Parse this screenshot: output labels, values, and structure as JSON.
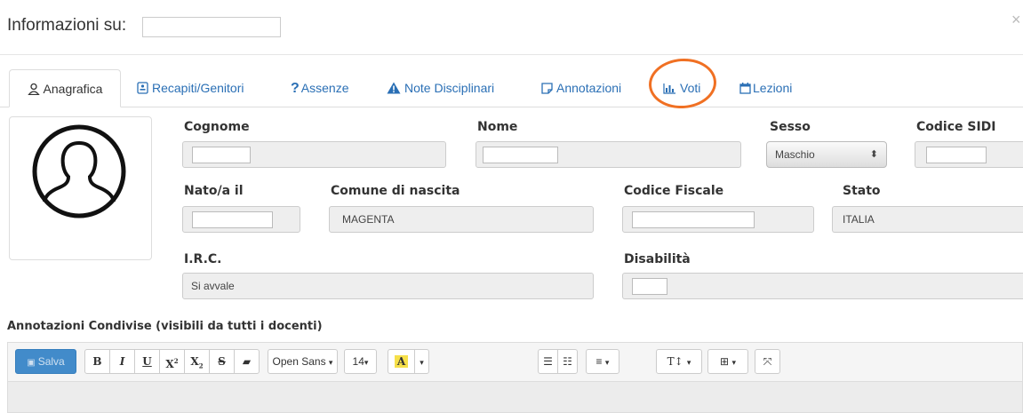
{
  "window": {
    "title": "Informazioni su:",
    "close": "×"
  },
  "tabs": [
    {
      "label": "Anagrafica",
      "icon": "user-icon"
    },
    {
      "label": "Recapiti/Genitori",
      "icon": "address-book-icon"
    },
    {
      "label": "Assenze",
      "icon": "question-icon"
    },
    {
      "label": "Note Disciplinari",
      "icon": "warning-icon"
    },
    {
      "label": "Annotazioni",
      "icon": "note-icon"
    },
    {
      "label": "Voti",
      "icon": "bar-chart-icon"
    },
    {
      "label": "Lezioni",
      "icon": "calendar-icon"
    }
  ],
  "form": {
    "cognome": {
      "label": "Cognome"
    },
    "nome": {
      "label": "Nome"
    },
    "sesso": {
      "label": "Sesso",
      "value": "Maschio"
    },
    "codice_sidi": {
      "label": "Codice SIDI"
    },
    "nato_il": {
      "label": "Nato/a il"
    },
    "comune": {
      "label": "Comune di nascita",
      "value": "MAGENTA"
    },
    "codice_fiscale": {
      "label": "Codice Fiscale"
    },
    "stato": {
      "label": "Stato",
      "value": "ITALIA"
    },
    "irc": {
      "label": "I.R.C.",
      "value": "Si avvale"
    },
    "disabilita": {
      "label": "Disabilità"
    }
  },
  "annotazioni": {
    "title": "Annotazioni Condivise (visibili da tutti i docenti)",
    "toolbar": {
      "save": "Salva",
      "bold": "B",
      "italic": "I",
      "underline": "U",
      "superscript": "X",
      "superscript_mark": "2",
      "subscript": "X",
      "subscript_mark": "2",
      "strike": "S",
      "font": "Open Sans",
      "size": "14",
      "color": "A",
      "caret": "▾"
    }
  },
  "accent": {
    "link": "#2a6fb5",
    "highlight": "#f07023",
    "save_button": "#428bca"
  }
}
